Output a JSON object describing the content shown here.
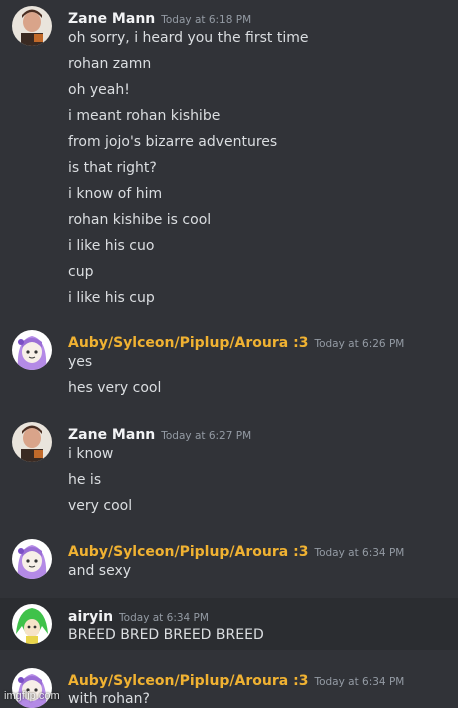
{
  "groups": [
    {
      "author": "Zane Mann",
      "author_color": "#f2f3f5",
      "timestamp": "Today at 6:18 PM",
      "messages": [
        "oh sorry, i heard you the first time",
        "rohan zamn",
        "oh yeah!",
        "i meant rohan kishibe",
        "from jojo's bizarre adventures",
        "is that right?",
        "i know of him",
        "rohan kishibe is cool",
        "i like his cuo",
        "cup",
        "i like his cup"
      ]
    },
    {
      "author": "Auby/Sylceon/Piplup/Aroura :3",
      "author_color": "#f0b232",
      "timestamp": "Today at 6:26 PM",
      "messages": [
        "yes",
        "hes very cool"
      ]
    },
    {
      "author": "Zane Mann",
      "author_color": "#f2f3f5",
      "timestamp": "Today at 6:27 PM",
      "messages": [
        "i know",
        "he is",
        "very cool"
      ]
    },
    {
      "author": "Auby/Sylceon/Piplup/Aroura :3",
      "author_color": "#f0b232",
      "timestamp": "Today at 6:34 PM",
      "messages": [
        "and sexy"
      ]
    },
    {
      "author": "airyin",
      "author_color": "#f2f3f5",
      "timestamp": "Today at 6:34 PM",
      "messages": [
        "BREED BRED BREED BREED"
      ]
    },
    {
      "author": "Auby/Sylceon/Piplup/Aroura :3",
      "author_color": "#f0b232",
      "timestamp": "Today at 6:34 PM",
      "messages": [
        "with rohan?"
      ]
    }
  ],
  "watermark": "imgflip.com"
}
